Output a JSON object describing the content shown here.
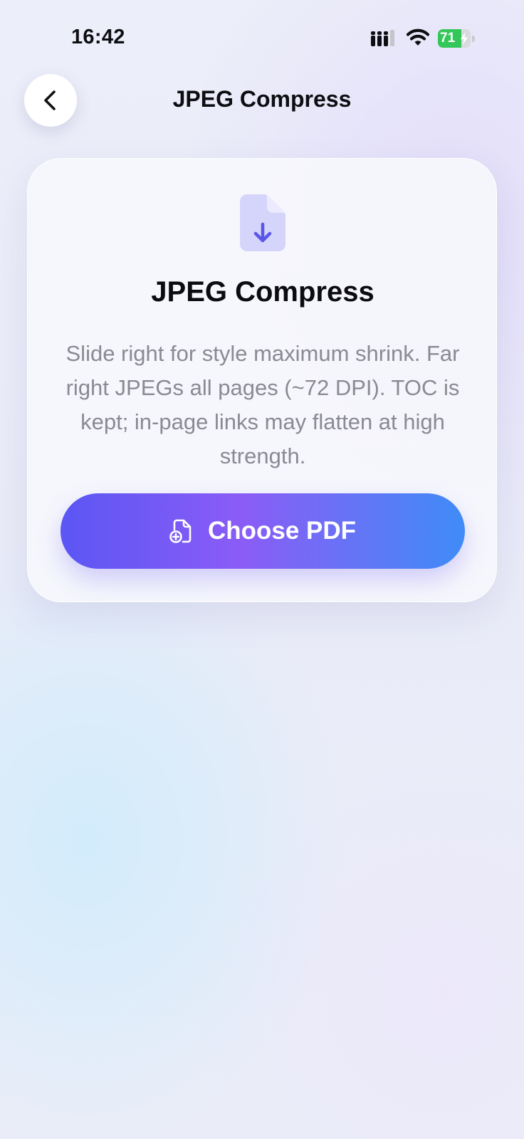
{
  "status_bar": {
    "time": "16:42",
    "battery_level": "71",
    "battery_percent": 71,
    "battery_charging": true,
    "signal_icon": "cellular-signal-icon",
    "wifi_icon": "wifi-icon"
  },
  "nav": {
    "back_icon": "chevron-left-icon",
    "title": "JPEG Compress"
  },
  "card": {
    "icon": "document-download-icon",
    "title": "JPEG Compress",
    "description": "Slide right for style maximum shrink. Far right JPEGs all pages (~72 DPI). TOC is kept; in-page links may flatten at high strength.",
    "button_icon": "document-add-icon",
    "button_label": "Choose PDF"
  },
  "colors": {
    "accent_start": "#5b56f4",
    "accent_mid": "#8b5cf6",
    "accent_end": "#3f8cf7",
    "battery_green": "#33c759",
    "doc_icon_fill": "#d5d4fb",
    "doc_icon_arrow": "#5b56e8"
  }
}
